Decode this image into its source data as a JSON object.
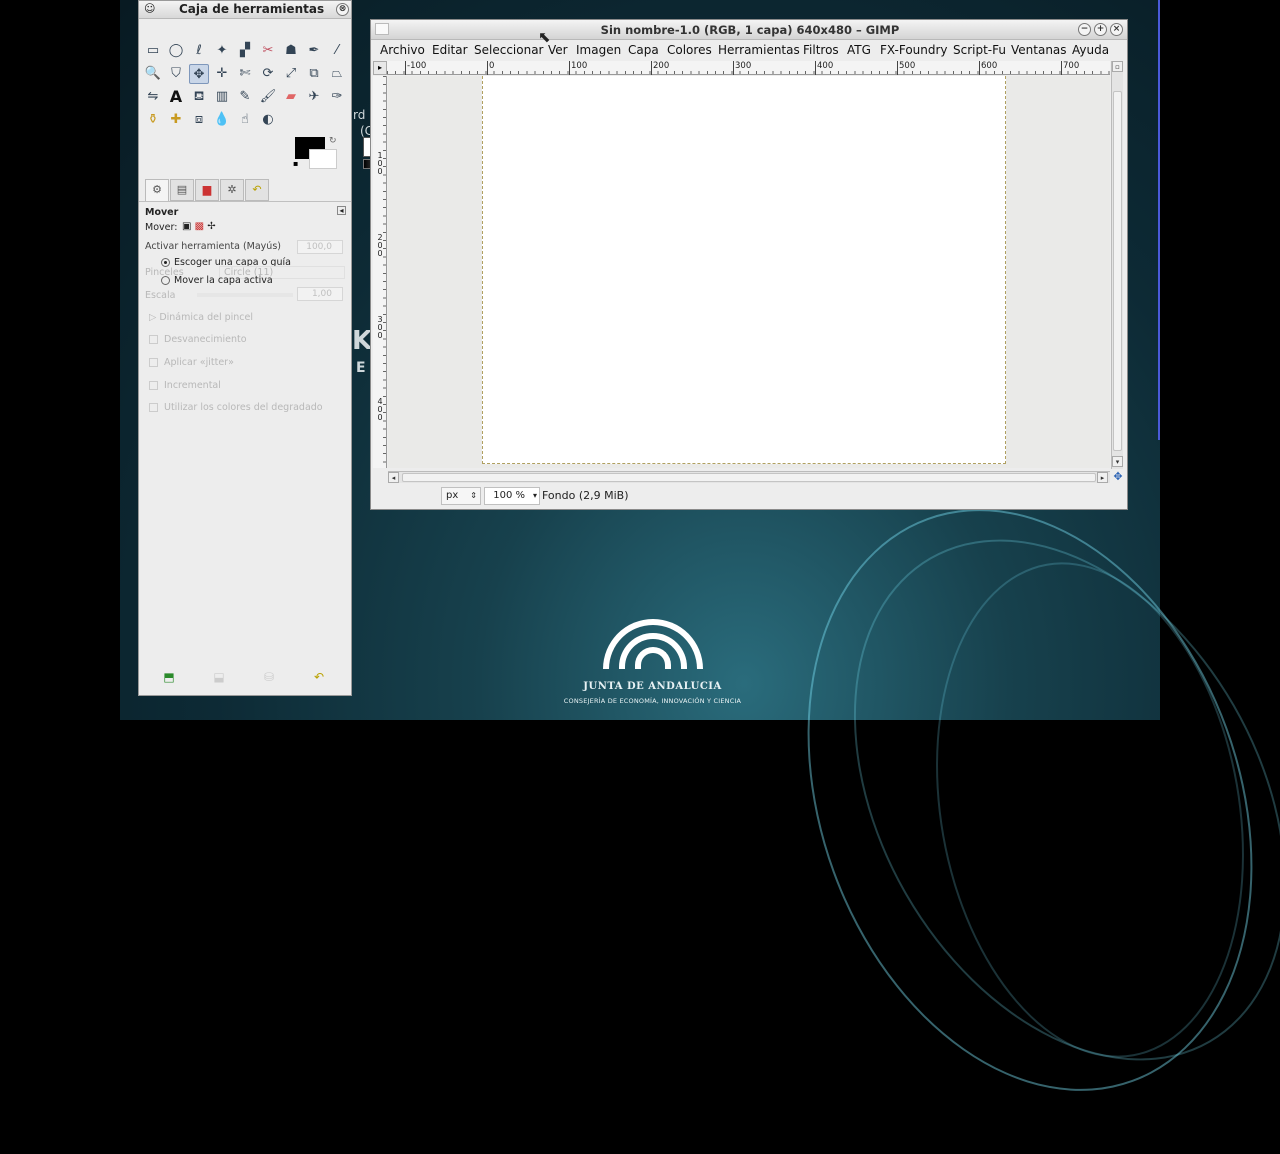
{
  "toolbox": {
    "title": "Caja de herramientas",
    "close_glyph": "⊗",
    "tools": [
      "rect-select",
      "ellipse-select",
      "free-select",
      "fuzzy-select",
      "color-select",
      "scissors",
      "foreground-select",
      "paths",
      "color-picker",
      "zoom",
      "measure",
      "move",
      "align",
      "crop",
      "rotate",
      "scale",
      "shear",
      "perspective",
      "flip",
      "text",
      "bucket-fill",
      "blend",
      "pencil",
      "paintbrush",
      "eraser",
      "airbrush",
      "ink",
      "clone",
      "heal",
      "perspective-clone",
      "blur",
      "smudge",
      "dodge-burn"
    ],
    "tool_options": {
      "title": "Mover",
      "mover_label": "Mover:",
      "activate_label": "Activar herramienta  (Mayús)",
      "opacity_value": "100,0",
      "brush_label": "Pinceles",
      "brush_value": "Circle (11)",
      "scale_label": "Escala",
      "scale_value": "1,00",
      "radio_pick": "Escoger una capa o guía",
      "radio_active": "Mover la capa activa",
      "dynamics": "Dinámica del pincel",
      "fade": "Desvanecimiento",
      "jitter": "Aplicar «jitter»",
      "incremental": "Incremental",
      "gradient": "Utilizar los colores del degradado"
    }
  },
  "image_window": {
    "title": "Sin nombre-1.0 (RGB, 1 capa) 640x480 – GIMP",
    "menus": [
      "Archivo",
      "Editar",
      "Seleccionar",
      "Ver",
      "Imagen",
      "Capa",
      "Colores",
      "Herramientas",
      "Filtros",
      "ATG",
      "FX-Foundry",
      "Script-Fu",
      "Ventanas",
      "Ayuda"
    ],
    "ruler_h": [
      "-100",
      "0",
      "100",
      "200",
      "300",
      "400",
      "500",
      "600",
      "700"
    ],
    "ruler_v": [
      "1\n0\n0",
      "2\n0\n0",
      "3\n0\n0",
      "4\n0\n0"
    ],
    "unit": "px",
    "zoom": "100 %",
    "layer_info": "Fondo (2,9 MiB)"
  },
  "desktop": {
    "logo_line1": "JUNTA DE ANDALUCIA",
    "logo_line2": "CONSEJERÍA DE ECONOMÍA, INNOVACIÓN Y CIENCIA",
    "bg_text1": "rd",
    "bg_text2": "(C",
    "bg_text3": "K",
    "bg_text4": "E"
  },
  "colors": {
    "accent": "#7e97bb",
    "desktop": "#17414d",
    "canvas": "#ffffff"
  }
}
